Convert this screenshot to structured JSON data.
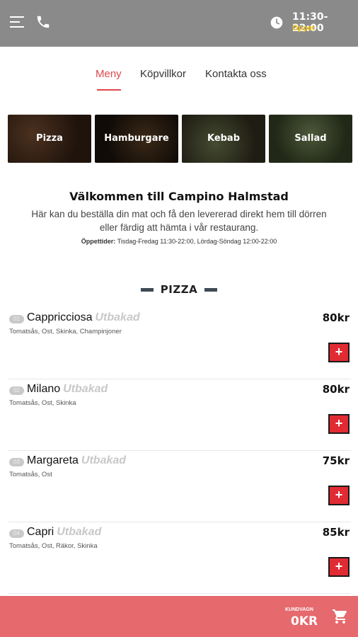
{
  "header": {
    "hours": "11:30-22:00",
    "status": "Öppet",
    "icons": [
      "menu-icon",
      "phone-icon",
      "clock-icon"
    ],
    "status_color": "#f5c518",
    "bar_color": "#8a8a8a"
  },
  "tabs": [
    {
      "label": "Meny",
      "active": true
    },
    {
      "label": "Köpvillkor",
      "active": false
    },
    {
      "label": "Kontakta oss",
      "active": false
    }
  ],
  "categories": [
    {
      "label": "Pizza"
    },
    {
      "label": "Hamburgare"
    },
    {
      "label": "Kebab"
    },
    {
      "label": "Sallad"
    }
  ],
  "welcome": {
    "title": "Välkommen till Campino Halmstad",
    "text_line1": "Här kan du beställa din mat och få den levererad direkt hem till dörren",
    "text_line2": "eller färdig att hämta i vår restaurang.",
    "hours_label": "Öppettider:",
    "hours_value": "Tisdag-Fredag 11:30-22:00, Lördag-Söndag 12:00-22:00"
  },
  "section": {
    "title": "PIZZA"
  },
  "menu_items": [
    {
      "num": "01",
      "name": "Cappricciosa",
      "tag": "Utbakad",
      "desc": "Tomatsås, Ost, Skinka, Champinjoner",
      "price": "80kr",
      "add": "+"
    },
    {
      "num": "02",
      "name": "Milano",
      "tag": "Utbakad",
      "desc": "Tomatsås, Ost, Skinka",
      "price": "80kr",
      "add": "+"
    },
    {
      "num": "03",
      "name": "Margareta",
      "tag": "Utbakad",
      "desc": "Tomatsås, Ost",
      "price": "75kr",
      "add": "+"
    },
    {
      "num": "04",
      "name": "Capri",
      "tag": "Utbakad",
      "desc": "Tomatsås, Ost, Räkor, Skinka",
      "price": "85kr",
      "add": "+"
    }
  ],
  "cart": {
    "label": "KUNDVAGN",
    "total": "0KR",
    "bar_color": "#e5696d"
  }
}
